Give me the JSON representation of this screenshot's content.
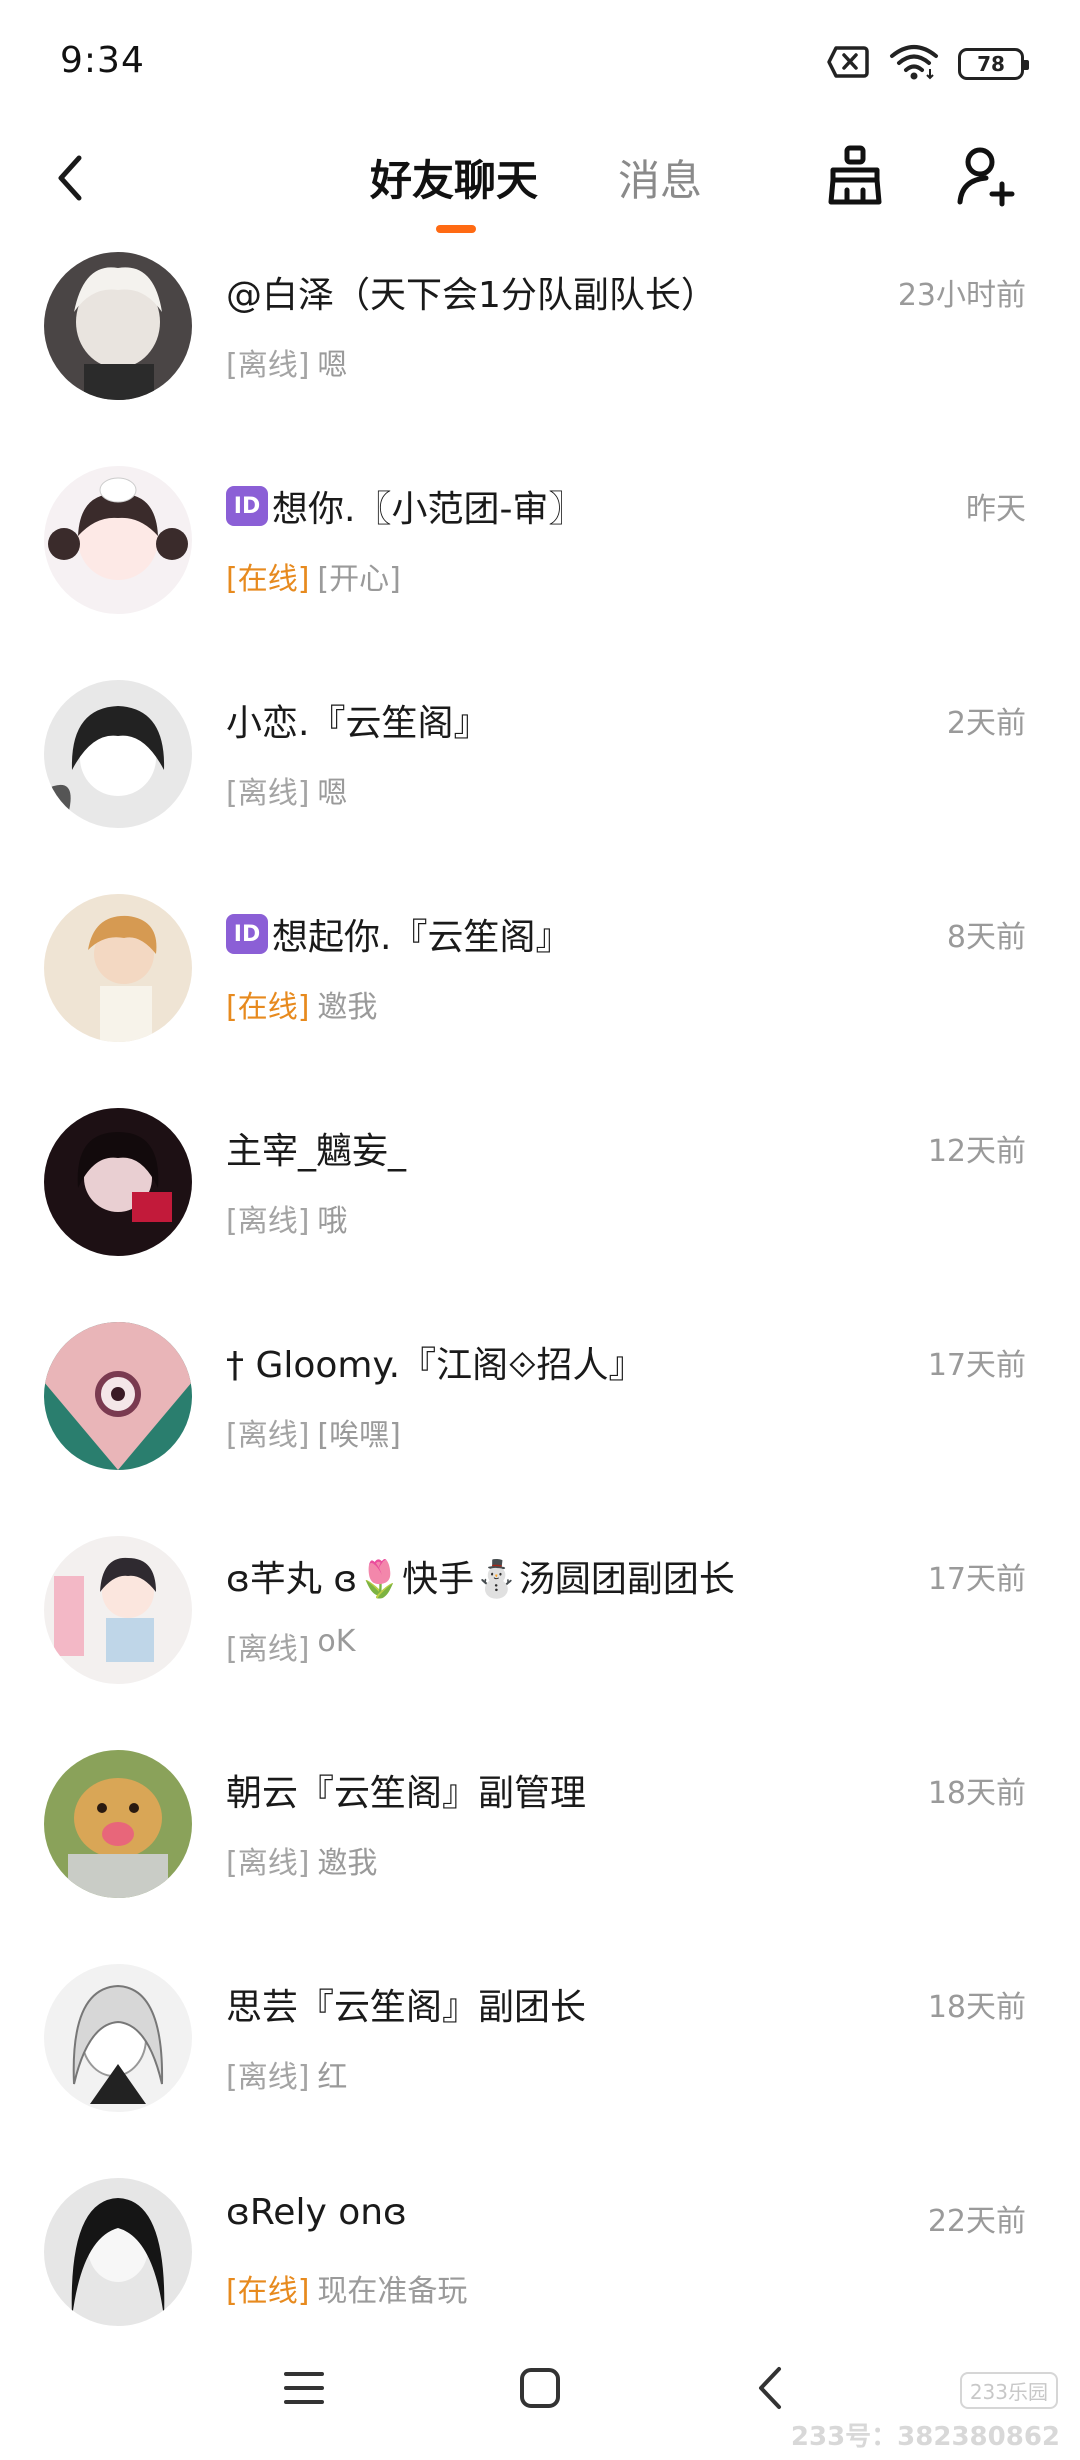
{
  "status_bar": {
    "time": "9:34",
    "battery": "78",
    "icons": [
      "sim-off-icon",
      "wifi-icon",
      "battery-icon"
    ]
  },
  "header": {
    "back_icon": "chevron-left-icon",
    "tabs": [
      {
        "label": "好友聊天",
        "active": true
      },
      {
        "label": "消息",
        "active": false
      }
    ],
    "clean_icon": "broom-icon",
    "add_friend_icon": "add-user-icon",
    "accent_color": "#ff6a13"
  },
  "chats": [
    {
      "id_badge": "",
      "name": "@白泽（天下会1分队副队长）",
      "time": "23小时前",
      "status": "[离线]",
      "online": false,
      "message": "嗯"
    },
    {
      "id_badge": "ID",
      "name": "想你.〖小范团-审〗",
      "time": "昨天",
      "status": "[在线]",
      "online": true,
      "message": "[开心]"
    },
    {
      "id_badge": "",
      "name": "小恋.『云笙阁』",
      "time": "2天前",
      "status": "[离线]",
      "online": false,
      "message": "嗯"
    },
    {
      "id_badge": "ID",
      "name": "想起你.『云笙阁』",
      "time": "8天前",
      "status": "[在线]",
      "online": true,
      "message": "邀我"
    },
    {
      "id_badge": "",
      "name": "主宰_魑妄_",
      "time": "12天前",
      "status": "[离线]",
      "online": false,
      "message": "哦"
    },
    {
      "id_badge": "",
      "name": "† Gloomy.『江阁⟐招人』",
      "time": "17天前",
      "status": "[离线]",
      "online": false,
      "message": "[唉嘿]"
    },
    {
      "id_badge": "",
      "name": "ɞ芊丸 ɞ🌷快手⛄汤圆团副团长",
      "time": "17天前",
      "status": "[离线]",
      "online": false,
      "message": "oK"
    },
    {
      "id_badge": "",
      "name": "朝云『云笙阁』副管理",
      "time": "18天前",
      "status": "[离线]",
      "online": false,
      "message": "邀我"
    },
    {
      "id_badge": "",
      "name": "思芸『云笙阁』副团长",
      "time": "18天前",
      "status": "[离线]",
      "online": false,
      "message": "红"
    },
    {
      "id_badge": "",
      "name": "ɞRely onɞ",
      "time": "22天前",
      "status": "[在线]",
      "online": true,
      "message": "现在准备玩"
    }
  ],
  "nav": {
    "menu_icon": "menu-icon",
    "home_icon": "square-home-icon",
    "back_icon": "back-triangle-icon"
  },
  "watermark": {
    "logo": "233乐园",
    "id_text": "233号：382380862"
  },
  "colors": {
    "online": "#e78a1e",
    "offline": "#a4a4a4",
    "time": "#9a9a9a",
    "id_badge": "#8b5fd6"
  }
}
